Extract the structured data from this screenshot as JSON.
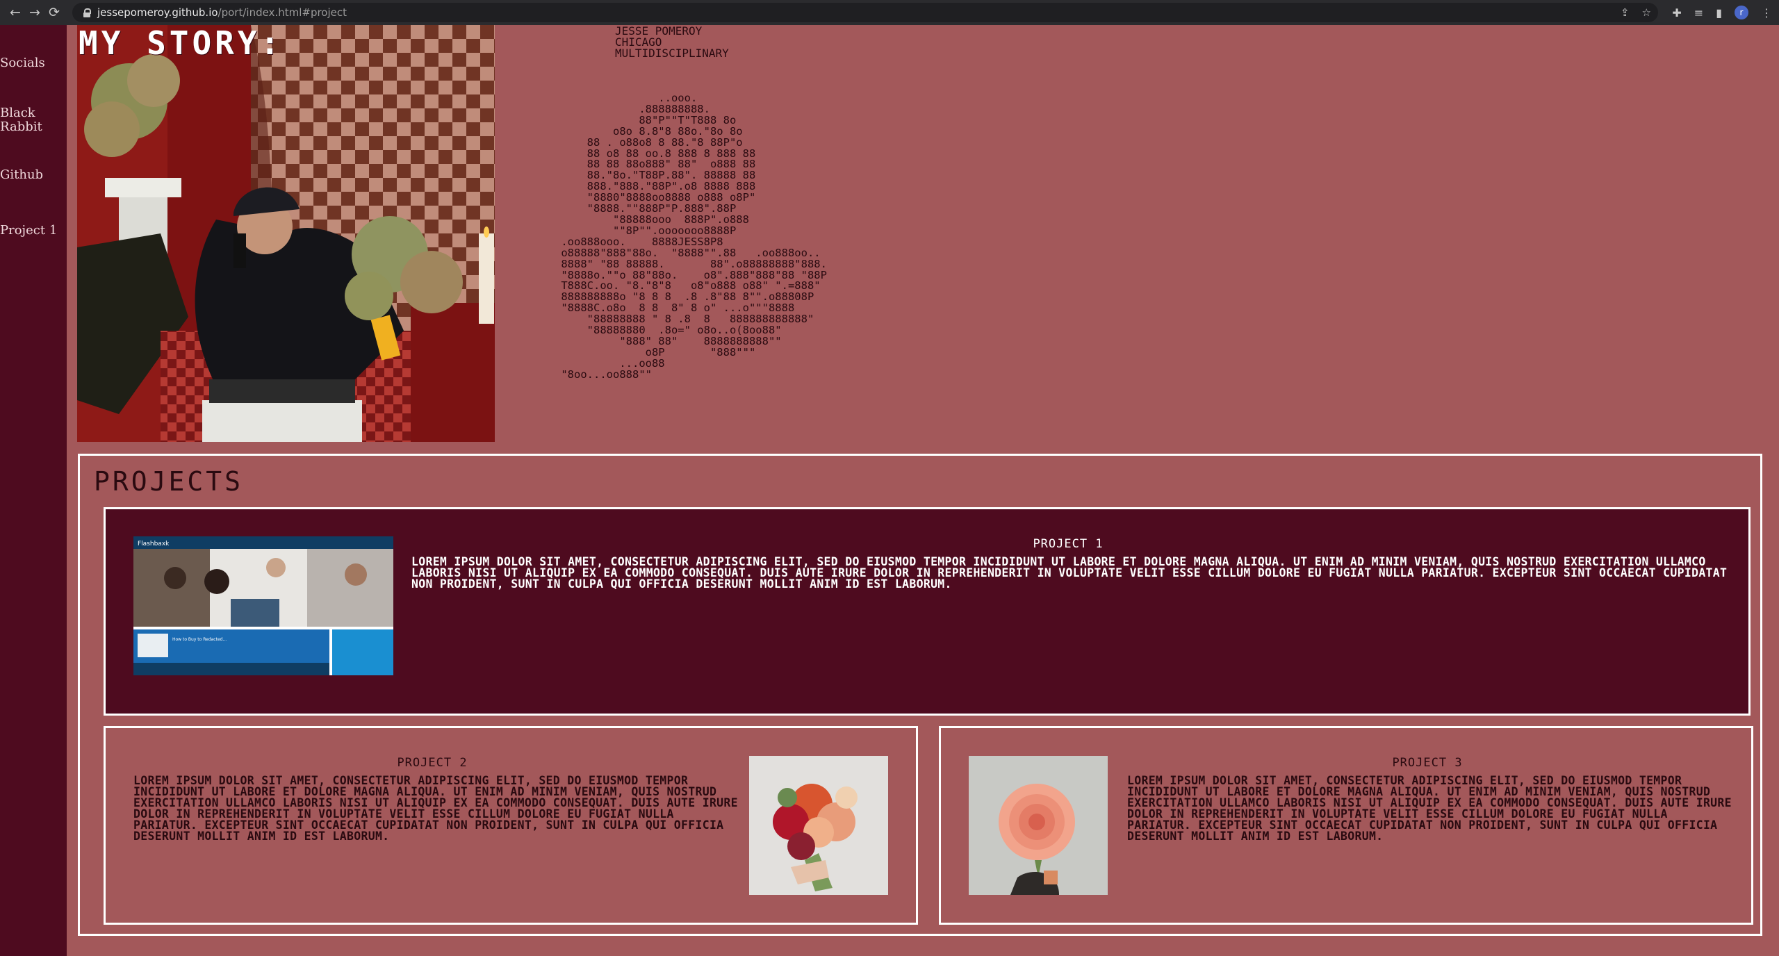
{
  "browser": {
    "url_host": "jessepomeroy.github.io",
    "url_path": "/port/index.html#project",
    "back_icon": "←",
    "forward_icon": "→",
    "reload_icon": "⟳",
    "profile_initial": "r"
  },
  "sidebar": {
    "items": [
      {
        "label": "Socials"
      },
      {
        "label": "Black Rabbit"
      },
      {
        "label": "Github"
      },
      {
        "label": "Project 1"
      }
    ]
  },
  "story": {
    "title": "MY STORY:",
    "bio": "JESSE POMEROY\nCHICAGO\nMULTIDISCIPLINARY",
    "ascii_art": "                ..ooo.\n             .888888888.\n             88\"P\"\"T\"T888 8o\n         o8o 8.8\"8 88o.\"8o 8o\n     88 . o88o8 8 88.\"8 88P\"o\n     88 o8 88 oo.8 888 8 888 88\n     88 88 88o888\" 88\"  o888 88\n     88.\"8o.\"T88P.88\". 88888 88\n     888.\"888.\"88P\".o8 8888 888\n     \"8880\"8888oo8888 o888 o8P\"\n     \"8888.\"\"888P\"P.888\".88P\n         \"88888ooo  888P\".o888\n         \"\"8P\"\".ooooooo8888P\n .oo888ooo.    8888JESS8P8\n o88888\"888\"88o.  \"8888\"\".88   .oo888oo..\n 8888\" \"88 88888.       88\".o88888888\"888.\n \"8888o.\"\"o 88\"88o.    o8\".888\"888\"88 \"88P\n T888C.oo. \"8.\"8\"8   o8\"o888 o88\" \".=888\"\n 888888888o \"8 8 8  .8 .8\"88 8\"\".o88808P\n \"8888C.o8o  8 8  8\" 8 o\" ...o\"\"\"8888\n     \"88888888 \" 8 .8  8   888888888888\"\n     \"88888880  .8o=\" o8o..o(8oo88\"\n          \"888\" 88\"    8888888888\"\"\n              o8P       \"888\"\"\"\n          ...oo88\n \"8oo...oo888\"\""
  },
  "projects": {
    "title": "PROJECTS",
    "items": [
      {
        "title": "PROJECT 1",
        "text": "LOREM IPSUM DOLOR SIT AMET, CONSECTETUR ADIPISCING ELIT, SED DO EIUSMOD TEMPOR INCIDIDUNT UT LABORE ET DOLORE MAGNA ALIQUA. UT ENIM AD MINIM VENIAM, QUIS NOSTRUD EXERCITATION ULLAMCO LABORIS NISI UT ALIQUIP EX EA COMMODO CONSEQUAT. DUIS AUTE IRURE DOLOR IN REPREHENDERIT IN VOLUPTATE VELIT ESSE CILLUM DOLORE EU FUGIAT NULLA PARIATUR. EXCEPTEUR SINT OCCAECAT CUPIDATAT NON PROIDENT, SUNT IN CULPA QUI OFFICIA DESERUNT MOLLIT ANIM ID EST LABORUM.",
        "thumb": {
          "brand": "Flashbaxk",
          "banner": "How to Buy to Redacted..."
        }
      },
      {
        "title": "PROJECT 2",
        "text": "LOREM IPSUM DOLOR SIT AMET, CONSECTETUR ADIPISCING ELIT, SED DO EIUSMOD TEMPOR INCIDIDUNT UT LABORE ET DOLORE MAGNA ALIQUA. UT ENIM AD MINIM VENIAM, QUIS NOSTRUD EXERCITATION ULLAMCO LABORIS NISI UT ALIQUIP EX EA COMMODO CONSEQUAT. DUIS AUTE IRURE DOLOR IN REPREHENDERIT IN VOLUPTATE VELIT ESSE CILLUM DOLORE EU FUGIAT NULLA PARIATUR. EXCEPTEUR SINT OCCAECAT CUPIDATAT NON PROIDENT, SUNT IN CULPA QUI OFFICIA DESERUNT MOLLIT ANIM ID EST LABORUM."
      },
      {
        "title": "PROJECT 3",
        "text": "LOREM IPSUM DOLOR SIT AMET, CONSECTETUR ADIPISCING ELIT, SED DO EIUSMOD TEMPOR INCIDIDUNT UT LABORE ET DOLORE MAGNA ALIQUA. UT ENIM AD MINIM VENIAM, QUIS NOSTRUD EXERCITATION ULLAMCO LABORIS NISI UT ALIQUIP EX EA COMMODO CONSEQUAT. DUIS AUTE IRURE DOLOR IN REPREHENDERIT IN VOLUPTATE VELIT ESSE CILLUM DOLORE EU FUGIAT NULLA PARIATUR. EXCEPTEUR SINT OCCAECAT CUPIDATAT NON PROIDENT, SUNT IN CULPA QUI OFFICIA DESERUNT MOLLIT ANIM ID EST LABORUM."
      }
    ]
  },
  "colors": {
    "page_bg": "#a3585a",
    "sidebar_bg": "#4e0b1f",
    "featured_card_bg": "#4e0b1f",
    "border": "#ffffff"
  }
}
